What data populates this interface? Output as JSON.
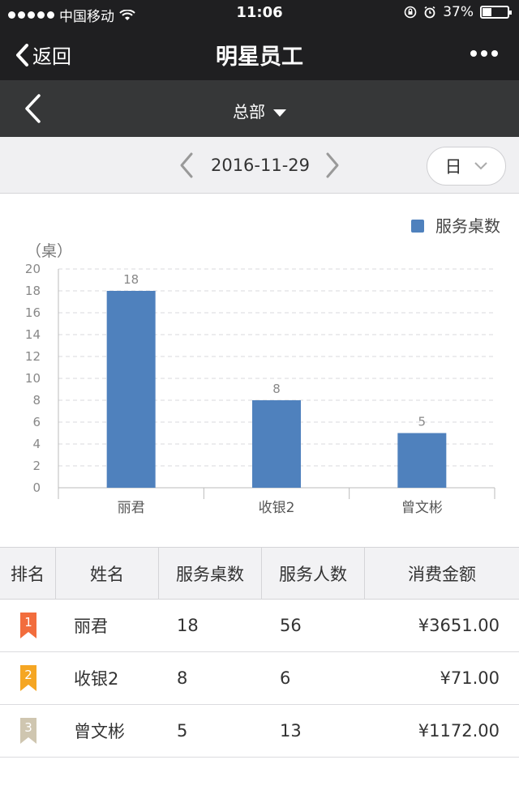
{
  "status": {
    "carrier": "中国移动",
    "time": "11:06",
    "battery": "37%"
  },
  "nav": {
    "back_label": "返回",
    "title": "明星员工"
  },
  "store": {
    "name": "总部"
  },
  "date_bar": {
    "date": "2016-11-29",
    "period": "日"
  },
  "chart_data": {
    "type": "bar",
    "categories": [
      "丽君",
      "收银2",
      "曾文彬"
    ],
    "series": [
      {
        "name": "服务桌数",
        "values": [
          18,
          8,
          5
        ]
      }
    ],
    "ylabel": "（桌）",
    "ylim": [
      0,
      20
    ],
    "yticks": [
      0,
      2,
      4,
      6,
      8,
      10,
      12,
      14,
      16,
      18,
      20
    ],
    "grid": true,
    "legend": "top-right",
    "color": "#4f81bd"
  },
  "table": {
    "headers": [
      "排名",
      "姓名",
      "服务桌数",
      "服务人数",
      "消费金额"
    ],
    "rows": [
      {
        "rank": "1",
        "name": "丽君",
        "tables": "18",
        "people": "56",
        "amount": "¥3651.00",
        "badge_color": "#f26d3d"
      },
      {
        "rank": "2",
        "name": "收银2",
        "tables": "8",
        "people": "6",
        "amount": "¥71.00",
        "badge_color": "#f5a623"
      },
      {
        "rank": "3",
        "name": "曾文彬",
        "tables": "5",
        "people": "13",
        "amount": "¥1172.00",
        "badge_color": "#cfc6b0"
      }
    ]
  }
}
